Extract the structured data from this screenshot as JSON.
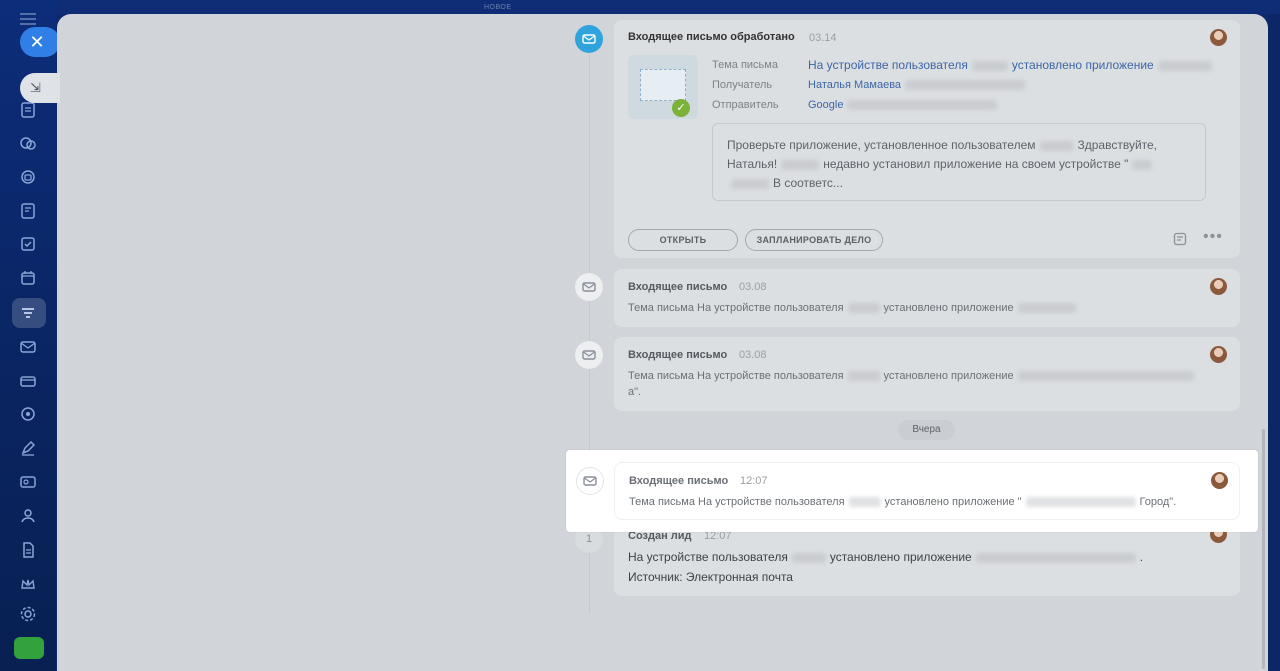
{
  "topbar": {
    "label": "НОВОЕ"
  },
  "rail": {
    "items": [
      "burger-icon",
      "close-icon",
      "pin-icon",
      "document-icon",
      "chat-icon",
      "support-icon",
      "notes-icon",
      "task-icon",
      "calendar-icon",
      "funnel-icon",
      "mail-icon",
      "card-icon",
      "target-icon",
      "pen-icon",
      "id-icon",
      "team-icon",
      "file-icon",
      "crown-icon",
      "settings-icon",
      "market-icon"
    ]
  },
  "timeline": {
    "processed": {
      "title": "Входящее письмо обработано",
      "time": "03.14",
      "subject_label": "Тема письма",
      "subject_prefix": "На устройстве пользователя",
      "subject_suffix": "установлено приложение",
      "recipient_label": "Получатель",
      "recipient_value": "Наталья Мамаева",
      "sender_label": "Отправитель",
      "sender_value": "Google",
      "body_line1_a": "Проверьте приложение, установленное пользователем",
      "body_line1_b": "Здравствуйте,",
      "body_line2_a": "Наталья!",
      "body_line2_b": "недавно установил приложение на своем устройстве \"",
      "body_line3": "В соответс...",
      "open_button": "ОТКРЫТЬ",
      "schedule_button": "ЗАПЛАНИРОВАТЬ ДЕЛО"
    },
    "email1": {
      "title": "Входящее письмо",
      "time": "03.08",
      "text_a": "Тема письма На устройстве пользователя",
      "text_b": "установлено приложение"
    },
    "email2": {
      "title": "Входящее письмо",
      "time": "03.08",
      "text_a": "Тема письма На устройстве пользователя",
      "text_b": "установлено приложение",
      "text_c": "а\"."
    },
    "date_separator": "Вчера",
    "email3": {
      "title": "Входящее письмо",
      "time": "12:07",
      "text_a": "Тема письма На устройстве пользователя",
      "text_b": "установлено приложение \"",
      "text_c": "Город\"."
    },
    "lead": {
      "title": "Создан лид",
      "time": "12:07",
      "line1_a": "На устройстве пользователя",
      "line1_b": "установлено приложение",
      "line1_c": ".",
      "line2": "Источник: Электронная почта"
    }
  },
  "colors": {
    "accent": "#2f7fe6",
    "timeline_blue": "#2fa4dc",
    "link": "#3c66a6",
    "success": "#7bb23a"
  }
}
